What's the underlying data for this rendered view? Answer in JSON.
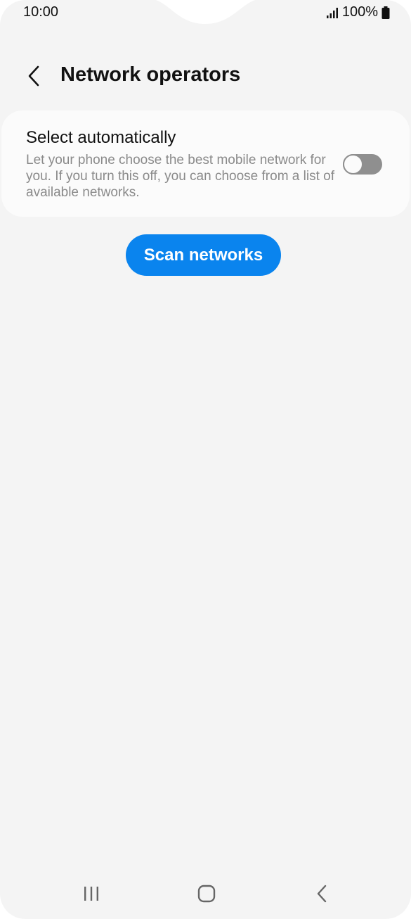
{
  "status_bar": {
    "time": "10:00",
    "battery": "100%",
    "icons": [
      "signal-icon",
      "battery-icon"
    ]
  },
  "header": {
    "title": "Network operators",
    "back_icon": "chevron-left-icon"
  },
  "select_automatically": {
    "title": "Select automatically",
    "description": "Let your phone choose the best mobile network for you. If you turn this off, you can choose from a list of available networks.",
    "toggle_state": "off"
  },
  "scan_button": {
    "label": "Scan networks"
  },
  "nav_bar": {
    "icons": [
      "recent-apps-icon",
      "home-icon",
      "back-icon"
    ]
  },
  "colors": {
    "accent": "#0a84ee",
    "background": "#f4f4f4",
    "card": "#fbfbfb",
    "toggle_off": "#8f8f8f"
  }
}
